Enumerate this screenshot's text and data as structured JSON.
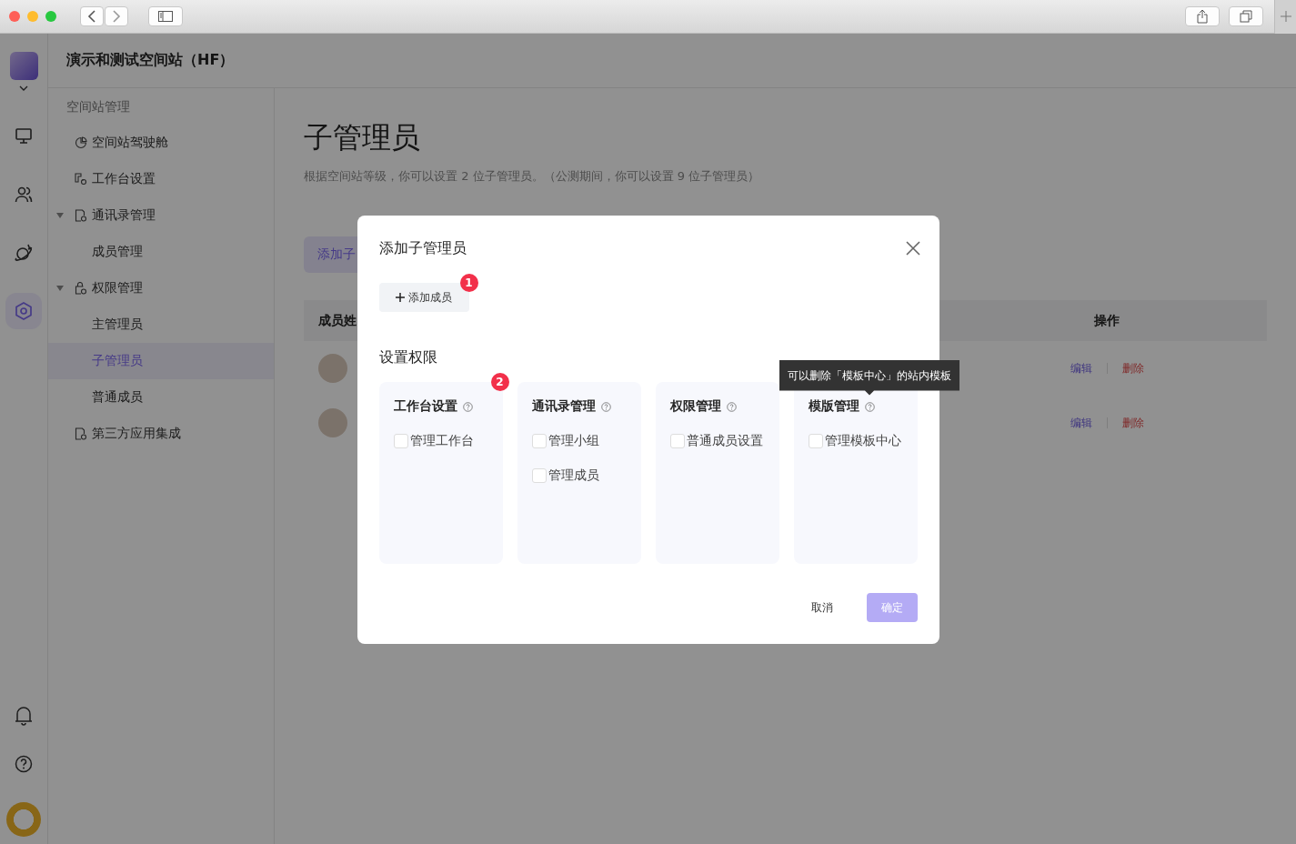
{
  "workspace": {
    "title": "演示和测试空间站（HF）"
  },
  "rail": {
    "items": [
      {
        "kind": "monitor",
        "selected": false
      },
      {
        "kind": "users",
        "selected": false
      },
      {
        "kind": "planet",
        "selected": false
      },
      {
        "kind": "settings",
        "selected": true
      }
    ]
  },
  "sidebar": {
    "section": "空间站管理",
    "items": [
      {
        "label": "空间站驾驶舱",
        "kind": "pie",
        "selected": false
      },
      {
        "label": "工作台设置",
        "kind": "workbench",
        "selected": false
      },
      {
        "label": "通讯录管理",
        "kind": "doc",
        "selected": false,
        "expanded": true,
        "children": [
          {
            "label": "成员管理",
            "selected": false
          }
        ]
      },
      {
        "label": "权限管理",
        "kind": "lock",
        "selected": false,
        "expanded": true,
        "children": [
          {
            "label": "主管理员",
            "selected": false
          },
          {
            "label": "子管理员",
            "selected": true
          },
          {
            "label": "普通成员",
            "selected": false
          }
        ]
      },
      {
        "label": "第三方应用集成",
        "kind": "doc",
        "selected": false
      }
    ]
  },
  "page": {
    "title": "子管理员",
    "description": "根据空间站等级，你可以设置 2 位子管理员。（公测期间，你可以设置 9 位子管理员）",
    "add_button": "添加子",
    "table": {
      "columns": [
        "成员姓",
        "操作"
      ],
      "rows": [
        {
          "actions": [
            {
              "label": "编辑",
              "kind": "edit"
            },
            {
              "label": "删除",
              "kind": "delete"
            }
          ]
        },
        {
          "actions": [
            {
              "label": "编辑",
              "kind": "edit"
            },
            {
              "label": "删除",
              "kind": "delete"
            }
          ]
        }
      ]
    }
  },
  "modal": {
    "title": "添加子管理员",
    "add_member": {
      "label": "添加成员",
      "badge": "1"
    },
    "section_title": "设置权限",
    "groups": [
      {
        "title": "工作台设置",
        "badge": "2",
        "options": [
          {
            "label": "管理工作台",
            "checked": false
          }
        ]
      },
      {
        "title": "通讯录管理",
        "options": [
          {
            "label": "管理小组",
            "checked": false
          },
          {
            "label": "管理成员",
            "checked": false
          }
        ]
      },
      {
        "title": "权限管理",
        "options": [
          {
            "label": "普通成员设置",
            "checked": false
          }
        ]
      },
      {
        "title": "模版管理",
        "tooltip": "可以删除「模板中心」的站内模板",
        "options": [
          {
            "label": "管理模板中心",
            "checked": false
          }
        ]
      }
    ],
    "cancel": "取消",
    "confirm": {
      "label": "确定",
      "disabled": true
    }
  }
}
